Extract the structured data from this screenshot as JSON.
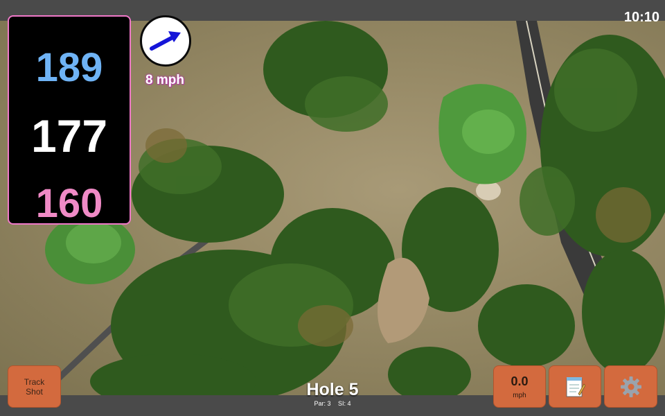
{
  "status": {
    "time": "10:10"
  },
  "distances": {
    "back": "189",
    "middle": "177",
    "front": "160"
  },
  "wind": {
    "speed": "8 mph",
    "icon": "wind-arrow-icon"
  },
  "hole": {
    "title": "Hole 5",
    "par": "Par: 3",
    "stroke_index": "SI: 4"
  },
  "buttons": {
    "track_shot": [
      "Track",
      "Shot"
    ],
    "shot_speed_value": "0.0",
    "shot_speed_unit": "mph",
    "notes_icon": "notepad-icon",
    "settings_icon": "gear-icon"
  },
  "colors": {
    "back": "#6fb3f5",
    "middle": "#ffffff",
    "front": "#f08ac6",
    "button": "#d36a3e",
    "panel_border": "#ef78c8"
  }
}
